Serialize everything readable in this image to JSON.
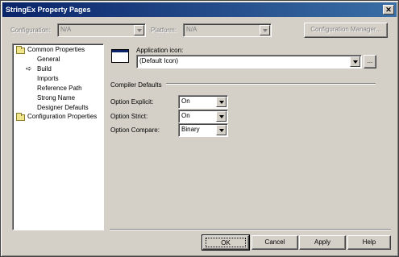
{
  "window": {
    "title": "StringEx Property Pages",
    "close_glyph": "✕"
  },
  "top_bar": {
    "configuration_label": "Configuration:",
    "configuration_value": "N/A",
    "platform_label": "Platform:",
    "platform_value": "N/A",
    "config_manager_label": "Configuration Manager..."
  },
  "tree": {
    "common_properties": "Common Properties",
    "children": [
      "General",
      "Build",
      "Imports",
      "Reference Path",
      "Strong Name",
      "Designer Defaults"
    ],
    "configuration_properties": "Configuration Properties",
    "selected_marker": "➪"
  },
  "main": {
    "app_icon_label": "Application icon:",
    "app_icon_value": "(Default Icon)",
    "browse_label": "...",
    "compiler_defaults_heading": "Compiler Defaults",
    "options": [
      {
        "label": "Option Explicit:",
        "value": "On"
      },
      {
        "label": "Option Strict:",
        "value": "On"
      },
      {
        "label": "Option Compare:",
        "value": "Binary"
      }
    ]
  },
  "buttons": {
    "ok": "OK",
    "cancel": "Cancel",
    "apply": "Apply",
    "help": "Help"
  },
  "icons": {
    "folder": "folder-icon",
    "app": "application-icon"
  }
}
